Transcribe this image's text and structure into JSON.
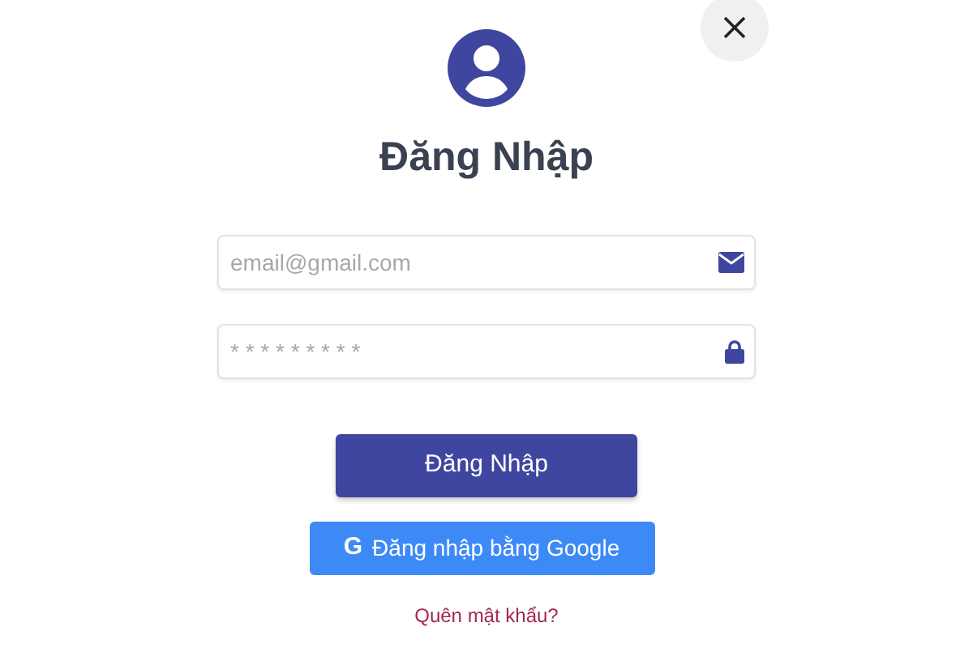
{
  "title": "Đăng Nhập",
  "fields": [
    {
      "kind": "email",
      "placeholder": "email@gmail.com"
    },
    {
      "kind": "password",
      "placeholder": "* * * * * * * * *"
    }
  ],
  "login_button": "Đăng Nhập",
  "google_button": {
    "icon": "G",
    "label": "Đăng nhập bằng Google"
  },
  "forgot_link": "Quên mật khẩu?"
}
